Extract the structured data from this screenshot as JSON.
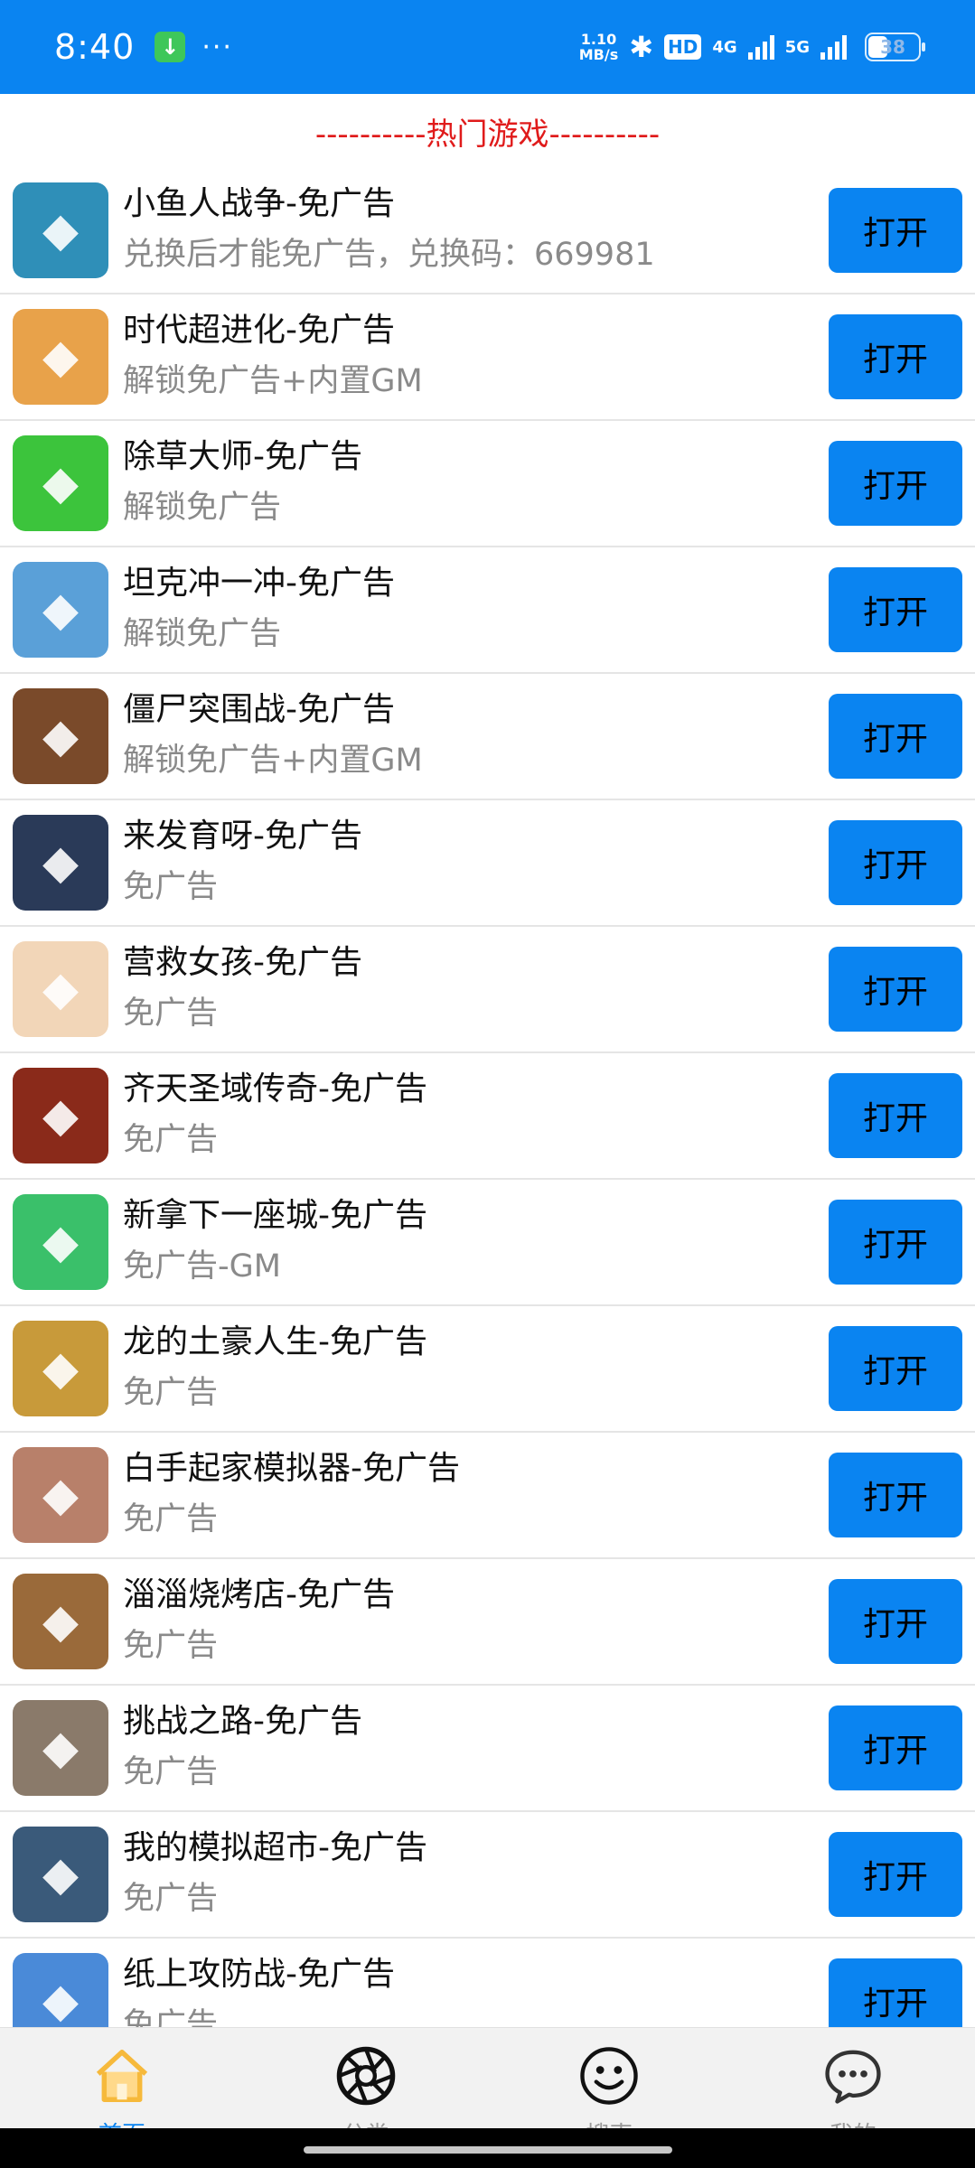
{
  "status_bar": {
    "time": "8:40",
    "download_icon": "download-icon",
    "dots": "···",
    "net_speed_value": "1.10",
    "net_speed_unit": "MB/s",
    "hd_label": "HD",
    "net_4g": "4G",
    "net_5g": "5G",
    "battery": "38"
  },
  "header": {
    "title": "----------热门游戏----------"
  },
  "open_label": "打开",
  "games": [
    {
      "name": "小鱼人战争-免广告",
      "desc": "兑换后才能免广告，兑换码：669981",
      "icon": "cartoon-boy-icon",
      "color": "#2f8fb8"
    },
    {
      "name": "时代超进化-免广告",
      "desc": "解锁免广告+内置GM",
      "icon": "caveman-icon",
      "color": "#e8a24a"
    },
    {
      "name": "除草大师-免广告",
      "desc": "解锁免广告",
      "icon": "lawnmower-icon",
      "color": "#3cc43c"
    },
    {
      "name": "坦克冲一冲-免广告",
      "desc": "解锁免广告",
      "icon": "tank-icon",
      "color": "#5aa0d8"
    },
    {
      "name": "僵尸突围战-免广告",
      "desc": "解锁免广告+内置GM",
      "icon": "zombie-bear-icon",
      "color": "#7a4a2a"
    },
    {
      "name": "来发育呀-免广告",
      "desc": "免广告",
      "icon": "nurse-zombie-icon",
      "color": "#2a3a58"
    },
    {
      "name": "营救女孩-免广告",
      "desc": "免广告",
      "icon": "princess-icon",
      "color": "#f2d6b8"
    },
    {
      "name": "齐天圣域传奇-免广告",
      "desc": "免广告",
      "icon": "warrior-icon",
      "color": "#8a2a1a"
    },
    {
      "name": "新拿下一座城-免广告",
      "desc": "免广告-GM",
      "icon": "king-catapult-icon",
      "color": "#3ac06a"
    },
    {
      "name": "龙的土豪人生-免广告",
      "desc": "免广告",
      "icon": "dragon-icon",
      "color": "#c89a3a"
    },
    {
      "name": "白手起家模拟器-免广告",
      "desc": "免广告",
      "icon": "woman-portrait-icon",
      "color": "#b8806a"
    },
    {
      "name": "淄淄烧烤店-免广告",
      "desc": "免广告",
      "icon": "bbq-icon",
      "color": "#9a6a3a"
    },
    {
      "name": "挑战之路-免广告",
      "desc": "免广告",
      "icon": "shouting-man-icon",
      "color": "#8a7a6a"
    },
    {
      "name": "我的模拟超市-免广告",
      "desc": "免广告",
      "icon": "cashier-icon",
      "color": "#3a5a7a"
    },
    {
      "name": "纸上攻防战-免广告",
      "desc": "免广告",
      "icon": "paper-army-icon",
      "color": "#4a8ad8"
    }
  ],
  "bottom_nav": [
    {
      "label": "首页",
      "icon": "home-icon",
      "active": true
    },
    {
      "label": "分类",
      "icon": "aperture-icon",
      "active": false
    },
    {
      "label": "搜索",
      "icon": "smiley-icon",
      "active": false
    },
    {
      "label": "我的",
      "icon": "chat-bubble-icon",
      "active": false
    }
  ]
}
